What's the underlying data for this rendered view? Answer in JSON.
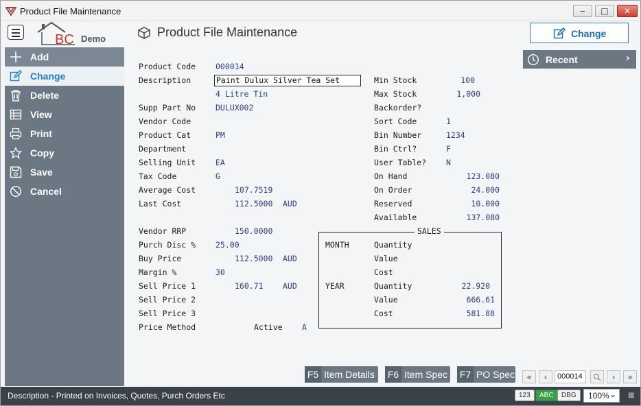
{
  "window": {
    "title": "Product File Maintenance",
    "min_glyph": "‒",
    "max_glyph": "□",
    "close_glyph": "✕"
  },
  "header": {
    "logo_letters": "BC",
    "logo_demo": "Demo",
    "page_title": "Product File Maintenance",
    "mode_button": "Change"
  },
  "sidebar": {
    "items": [
      {
        "label": "Add",
        "icon": "plus-icon"
      },
      {
        "label": "Change",
        "icon": "pencil-icon",
        "active": true
      },
      {
        "label": "Delete",
        "icon": "trash-icon"
      },
      {
        "label": "View",
        "icon": "table-icon"
      },
      {
        "label": "Print",
        "icon": "printer-icon"
      },
      {
        "label": "Copy",
        "icon": "star-icon"
      },
      {
        "label": "Save",
        "icon": "floppy-icon"
      },
      {
        "label": "Cancel",
        "icon": "cancel-icon"
      }
    ]
  },
  "recent": {
    "label": "Recent",
    "chevron": "›"
  },
  "form": {
    "left": [
      {
        "label": "Product Code",
        "value": "000014"
      },
      {
        "label": "Description",
        "value": "Paint Dulux Silver Tea Set"
      },
      {
        "label": "",
        "value": "4 Litre Tin"
      },
      {
        "label": "Supp Part No",
        "value": "DULUX002"
      },
      {
        "label": "Vendor Code",
        "value": ""
      },
      {
        "label": "Product Cat",
        "value": "PM"
      },
      {
        "label": "Department",
        "value": ""
      },
      {
        "label": "Selling Unit",
        "value": "EA"
      },
      {
        "label": "Tax Code",
        "value": "G"
      },
      {
        "label": "Average Cost",
        "value": "107.7519"
      },
      {
        "label": "Last Cost",
        "value": "112.5000",
        "currency": "AUD"
      },
      {
        "label": "Vendor RRP",
        "value": "150.0000"
      },
      {
        "label": "Purch Disc %",
        "value": "25.00"
      },
      {
        "label": "Buy Price",
        "value": "112.5000",
        "currency": "AUD"
      },
      {
        "label": "Margin %",
        "value": "30"
      },
      {
        "label": "Sell Price 1",
        "value": "160.71",
        "currency": "AUD"
      },
      {
        "label": "Sell Price 2",
        "value": ""
      },
      {
        "label": "Sell Price 3",
        "value": ""
      },
      {
        "label": "Price Method",
        "value": ""
      }
    ],
    "active_label": "Active",
    "active_value": "A",
    "right": [
      {
        "label": "Min Stock",
        "value": "100"
      },
      {
        "label": "Max Stock",
        "value": "1,000"
      },
      {
        "label": "Backorder?",
        "value": ""
      },
      {
        "label": "Sort Code",
        "value": "1"
      },
      {
        "label": "Bin Number",
        "value": "1234"
      },
      {
        "label": "Bin Ctrl?",
        "value": "F"
      },
      {
        "label": "User Table?",
        "value": "N"
      },
      {
        "label": "On Hand",
        "value": "123.080"
      },
      {
        "label": "On Order",
        "value": "24.000"
      },
      {
        "label": "Reserved",
        "value": "10.000"
      },
      {
        "label": "Available",
        "value": "137.080"
      }
    ],
    "sales": {
      "title": "SALES",
      "month_label": "MONTH",
      "year_label": "YEAR",
      "month": [
        {
          "label": "Quantity",
          "value": ""
        },
        {
          "label": "Value",
          "value": ""
        },
        {
          "label": "Cost",
          "value": ""
        }
      ],
      "year": [
        {
          "label": "Quantity",
          "value": "22.920"
        },
        {
          "label": "Value",
          "value": "666.61"
        },
        {
          "label": "Cost",
          "value": "581.88"
        }
      ]
    }
  },
  "fkeys": [
    {
      "key": "F5",
      "label": "Item Details"
    },
    {
      "key": "F6",
      "label": "Item Spec"
    },
    {
      "key": "F7",
      "label": "PO Spec"
    }
  ],
  "nav": {
    "first": "«",
    "prev": "‹",
    "record": "000014",
    "next": "›",
    "last": "»"
  },
  "status": {
    "text": "Description - Printed on Invoices, Quotes, Purch Orders Etc",
    "pill_123": "123",
    "pill_abc": "ABC",
    "pill_dbg": "DBG",
    "zoom": "100%",
    "zoom_caret": "⌄",
    "grip": "▦"
  }
}
